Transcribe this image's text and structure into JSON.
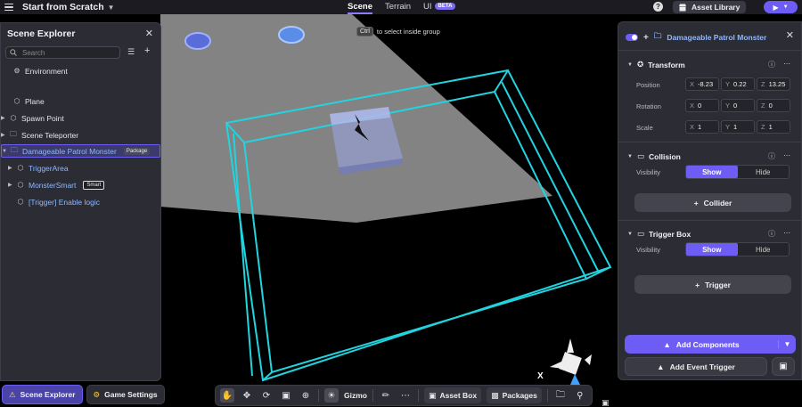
{
  "header": {
    "project_title": "Start from Scratch",
    "tabs": [
      {
        "label": "Scene"
      },
      {
        "label": "Terrain"
      },
      {
        "label": "UI"
      }
    ],
    "beta_badge": "BETA",
    "asset_library_label": "Asset Library"
  },
  "viewport_hint": {
    "key": "Ctrl",
    "text": "to select inside group"
  },
  "gizmo_axis_label": "X",
  "scene_explorer": {
    "title": "Scene Explorer",
    "search_placeholder": "Search",
    "items": [
      {
        "label": "Environment"
      },
      {
        "label": "Plane"
      },
      {
        "label": "Spawn Point"
      },
      {
        "label": "Scene Teleporter"
      },
      {
        "label": "Damageable Patrol Monster",
        "badge": "Package"
      },
      {
        "label": "TriggerArea"
      },
      {
        "label": "MonsterSmart",
        "badge": "Smart"
      },
      {
        "label": "[Trigger] Enable logic"
      }
    ]
  },
  "bottom_bar": {
    "scene_explorer": "Scene Explorer",
    "game_settings": "Game Settings"
  },
  "toolbar": {
    "gizmo": "Gizmo",
    "asset_box": "Asset Box",
    "packages": "Packages"
  },
  "inspector": {
    "object_name": "Damageable Patrol Monster",
    "transform": {
      "title": "Transform",
      "position_label": "Position",
      "rotation_label": "Rotation",
      "scale_label": "Scale",
      "position": {
        "x": "-8.23",
        "y": "0.22",
        "z": "13.25"
      },
      "rotation": {
        "x": "0",
        "y": "0",
        "z": "0"
      },
      "scale": {
        "x": "1",
        "y": "1",
        "z": "1"
      }
    },
    "collision": {
      "title": "Collision",
      "visibility_label": "Visibility",
      "show": "Show",
      "hide": "Hide",
      "add_label": "Collider"
    },
    "trigger_box": {
      "title": "Trigger Box",
      "visibility_label": "Visibility",
      "show": "Show",
      "hide": "Hide",
      "add_label": "Trigger"
    },
    "add_components": "Add Components",
    "add_event_trigger": "Add Event Trigger"
  },
  "colors": {
    "accent": "#6d5df5",
    "wireframe": "#22d3e0",
    "panel": "#2c2c34"
  }
}
